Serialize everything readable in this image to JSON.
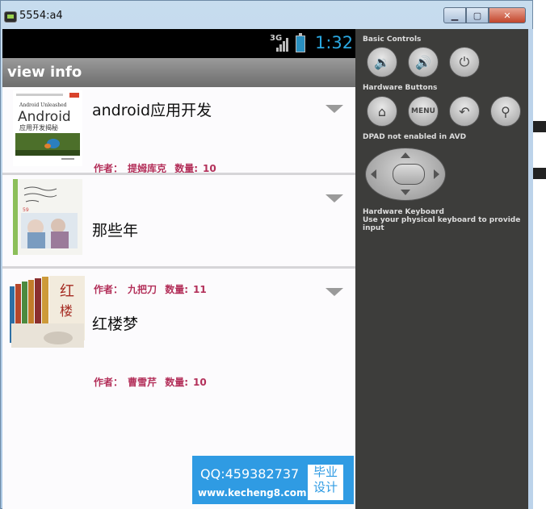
{
  "window": {
    "title": "5554:a4",
    "buttons": {
      "minimize": "▁",
      "maximize": "▢",
      "close": "✕"
    }
  },
  "statusbar": {
    "network": "3G",
    "time": "1:32"
  },
  "app": {
    "title": "view info"
  },
  "books": [
    {
      "title": "android应用开发",
      "author_label": "作者：",
      "author": "提姆库克",
      "count_label": "数量:",
      "count": "10",
      "cover_title_en": "Android Unleashed",
      "cover_title_cn": "Android",
      "cover_subtitle": "应用开发揭秘"
    },
    {
      "title": "那些年",
      "author_label": "作者：",
      "author": "九把刀",
      "count_label": "数量:",
      "count": "11"
    },
    {
      "title": "红楼梦",
      "author_label": "作者：",
      "author": "曹雪芹",
      "count_label": "数量:",
      "count": "10"
    }
  ],
  "controls": {
    "basic_label": "Basic Controls",
    "hardware_label": "Hardware Buttons",
    "menu_label": "MENU",
    "dpad_label": "DPAD not enabled in AVD",
    "keyboard_label": "Hardware Keyboard",
    "keyboard_hint": "Use your physical keyboard to provide input"
  },
  "watermark": {
    "qq": "QQ:459382737",
    "url": "www.kecheng8.com",
    "badge_line1": "毕业",
    "badge_line2": "设计"
  },
  "colors": {
    "accent_time": "#2aa7e0",
    "meta_text": "#b3305a",
    "watermark_bg": "#2f9be3"
  }
}
